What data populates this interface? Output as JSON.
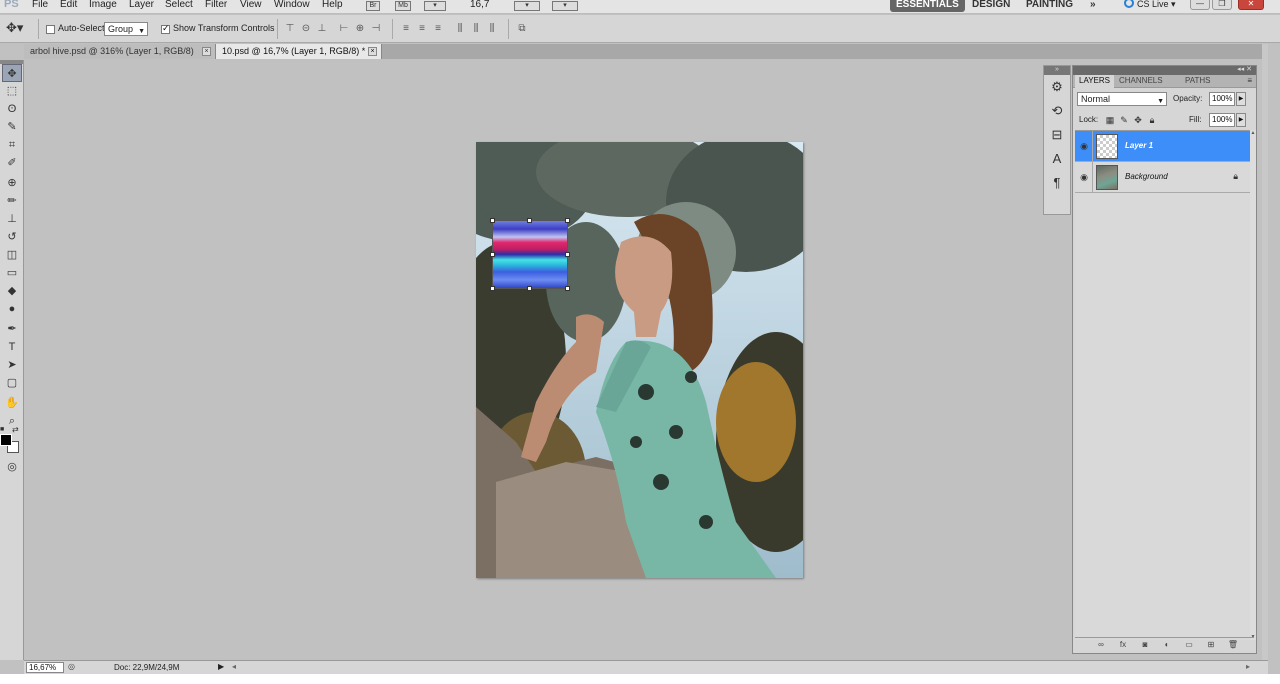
{
  "menubar": {
    "logo": "PS",
    "items": [
      "File",
      "Edit",
      "Image",
      "Layer",
      "Select",
      "Filter",
      "View",
      "Window",
      "Help"
    ],
    "mb_icons": [
      "Br",
      "Mb"
    ],
    "zoom": "16,7",
    "workspaces": [
      "ESSENTIALS",
      "DESIGN",
      "PAINTING"
    ],
    "more": "»",
    "cs_live": "CS Live",
    "win_controls": [
      "—",
      "❐",
      "✕"
    ]
  },
  "options": {
    "auto_select_label": "Auto-Select:",
    "auto_select_checked": false,
    "auto_select_value": "Group",
    "show_transform_label": "Show Transform Controls",
    "show_transform_checked": true
  },
  "tabs": [
    {
      "label": "arbol hive.psd @ 316% (Layer 1, RGB/8)",
      "close": "×",
      "active": false
    },
    {
      "label": "10.psd @ 16,7% (Layer 1, RGB/8) *",
      "close": "×",
      "active": true
    }
  ],
  "tools": [
    "move-tool",
    "marquee-tool",
    "lasso-tool",
    "quick-selection-tool",
    "crop-tool",
    "eyedropper-tool",
    "healing-brush-tool",
    "brush-tool",
    "clone-stamp-tool",
    "history-brush-tool",
    "eraser-tool",
    "gradient-tool",
    "blur-tool",
    "dodge-tool",
    "pen-tool",
    "type-tool",
    "path-selection-tool",
    "rectangle-tool",
    "hand-tool",
    "zoom-tool"
  ],
  "tool_glyphs": [
    "✥",
    "⬚",
    "ʘ",
    "✎",
    "⌗",
    "✐",
    "⊕",
    "✏",
    "⊥",
    "↺",
    "◫",
    "▭",
    "◆",
    "●",
    "✒",
    "T",
    "➤",
    "▢",
    "✋",
    "⌕"
  ],
  "colors": {
    "foreground": "#000000",
    "background": "#ffffff",
    "selection_accent": "#3d8ef8"
  },
  "layers_panel": {
    "tabs": [
      "LAYERS",
      "CHANNELS",
      "PATHS"
    ],
    "blend_mode": "Normal",
    "opacity_label": "Opacity:",
    "opacity": "100%",
    "lock_label": "Lock:",
    "fill_label": "Fill:",
    "fill": "100%",
    "layers": [
      {
        "name": "Layer 1",
        "selected": true,
        "visible": true,
        "locked": false
      },
      {
        "name": "Background",
        "selected": false,
        "visible": true,
        "locked": true
      }
    ]
  },
  "statusbar": {
    "zoom": "16,67%",
    "doc_info": "Doc: 22,9M/24,9M"
  }
}
